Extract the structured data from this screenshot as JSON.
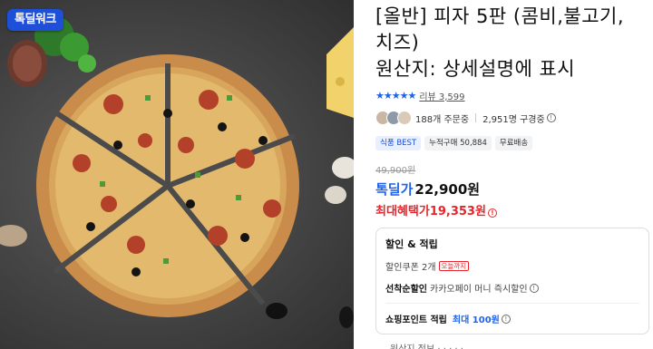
{
  "image": {
    "logo_text": "톡딜워크",
    "alt_icon": "pizza-photo"
  },
  "product": {
    "title_line1": "[올반] 피자 5판 (콤비,불고기,",
    "title_line2": "치즈)",
    "title_line3": "원산지: 상세설명에 표시",
    "stars": "★★★★★",
    "review_text": "리뷰 3,599",
    "orders_text": "188개 주문중",
    "viewers_text": "2,951명 구경중",
    "tags": [
      "식품 BEST",
      "누적구매 50,884",
      "무료배송"
    ],
    "original_price": "49,900원",
    "deal_label": "톡딜가",
    "deal_price": "22,900원",
    "benefit_label": "최대혜택가",
    "benefit_price": "19,353원",
    "colors": {
      "accent_blue": "#1e63e9",
      "accent_red": "#e8232a"
    }
  },
  "benefits": {
    "title": "할인 & 적립",
    "coupon_text": "할인쿠폰 2개",
    "coupon_chip": "오늘까지",
    "instant_label": "선착순할인",
    "instant_text": "카카오페이 머니 즉시할인",
    "points_label": "쇼핑포인트 적립",
    "points_text": "최대 100원"
  },
  "footer": {
    "note": "원산지 정보 ·  ·  ·  ·  · "
  }
}
